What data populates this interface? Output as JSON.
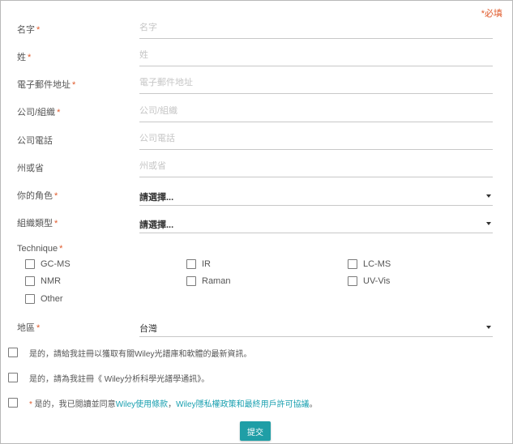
{
  "form": {
    "required_note": "*必填",
    "fields": {
      "first_name": {
        "label": "名字",
        "placeholder": "名字",
        "value": ""
      },
      "last_name": {
        "label": "姓",
        "placeholder": "姓",
        "value": ""
      },
      "email": {
        "label": "電子郵件地址",
        "placeholder": "電子郵件地址",
        "value": ""
      },
      "company": {
        "label": "公司/組織",
        "placeholder": "公司/組織",
        "value": ""
      },
      "phone": {
        "label": "公司電話",
        "placeholder": "公司電話",
        "value": ""
      },
      "state": {
        "label": "州或省",
        "placeholder": "州或省",
        "value": ""
      }
    },
    "required_marker": "*",
    "role": {
      "label": "你的角色",
      "selected": "請選擇..."
    },
    "org_type": {
      "label": "組織類型",
      "selected": "請選擇..."
    },
    "technique": {
      "label": "Technique",
      "options": [
        "GC-MS",
        "IR",
        "LC-MS",
        "NMR",
        "Raman",
        "UV-Vis",
        "Other"
      ]
    },
    "region": {
      "label": "地區",
      "selected": "台灣"
    },
    "consents": {
      "c1": "是的，請給我註冊以獲取有關Wiley光譜庫和軟體的最新資訊。",
      "c2": "是的，請為我註冊《 Wiley分析科學光譜學通訊》。",
      "c3": {
        "star": "*",
        "prefix": " 是的，我已閱讀並同意",
        "link1": "Wiley使用條款",
        "mid": "，",
        "link2": "Wiley隱私權政策和最終用戶許可協議",
        "suffix": "。"
      }
    },
    "submit_label": "提交"
  },
  "colors": {
    "accent": "#1f9ea6",
    "link": "#1aa0b0",
    "required": "#e05a2b"
  }
}
